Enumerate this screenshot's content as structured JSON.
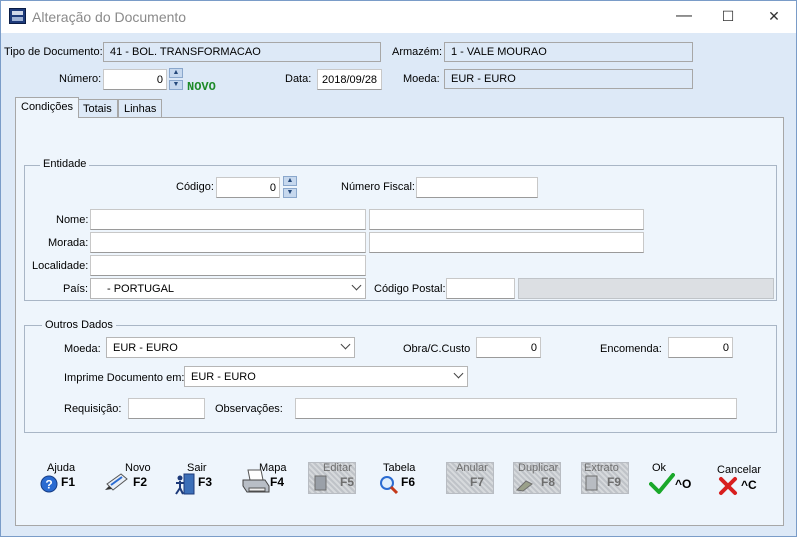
{
  "window": {
    "title": "Alteração do Documento",
    "minimize": "—",
    "maximize": "☐",
    "close": "✕"
  },
  "header": {
    "tipo_label": "Tipo de Documento:",
    "tipo_value": "41 - BOL. TRANSFORMACAO",
    "armazem_label": "Armazém:",
    "armazem_value": "1 - VALE MOURAO",
    "numero_label": "Número:",
    "numero_value": "0",
    "novo": "NOVO",
    "data_label": "Data:",
    "data_value": "2018/09/28",
    "moeda_label": "Moeda:",
    "moeda_value": "EUR - EURO"
  },
  "tabs": [
    {
      "label": "Condições"
    },
    {
      "label": "Totais"
    },
    {
      "label": "Linhas"
    }
  ],
  "entidade": {
    "legend": "Entidade",
    "codigo_label": "Código:",
    "codigo_value": "0",
    "nif_label": "Número Fiscal:",
    "nif_value": "",
    "nome_label": "Nome:",
    "nome_value": "",
    "nome2_value": "",
    "morada_label": "Morada:",
    "morada_value": "",
    "morada2_value": "",
    "localidade_label": "Localidade:",
    "localidade_value": "",
    "pais_label": "País:",
    "pais_value": "- PORTUGAL",
    "cp_label": "Código Postal:",
    "cp_value": "",
    "cp_desc_value": ""
  },
  "outros": {
    "legend": "Outros Dados",
    "moeda_label": "Moeda:",
    "moeda_value": "EUR - EURO",
    "obra_label": "Obra/C.Custo",
    "obra_value": "0",
    "encomenda_label": "Encomenda:",
    "encomenda_value": "0",
    "imprime_label": "Imprime Documento em:",
    "imprime_value": "EUR - EURO",
    "requisicao_label": "Requisição:",
    "requisicao_value": "",
    "observacoes_label": "Observações:",
    "observacoes_value": ""
  },
  "toolbar": [
    {
      "caption": "Ajuda",
      "key": "F1",
      "icon": "help-icon",
      "enabled": true
    },
    {
      "caption": "Novo",
      "key": "F2",
      "icon": "new-document-icon",
      "enabled": true
    },
    {
      "caption": "Sair",
      "key": "F3",
      "icon": "exit-door-icon",
      "enabled": true
    },
    {
      "caption": "Mapa",
      "key": "F4",
      "icon": "printer-icon",
      "enabled": true
    },
    {
      "caption": "Editar",
      "key": "F5",
      "icon": "edit-icon",
      "enabled": false
    },
    {
      "caption": "Tabela",
      "key": "F6",
      "icon": "magnifier-icon",
      "enabled": true
    },
    {
      "caption": "Anular",
      "key": "F7",
      "icon": "cancel-doc-icon",
      "enabled": false
    },
    {
      "caption": "Duplicar",
      "key": "F8",
      "icon": "duplicate-icon",
      "enabled": false
    },
    {
      "caption": "Extrato",
      "key": "F9",
      "icon": "statement-icon",
      "enabled": false
    },
    {
      "caption": "Ok",
      "key": "^O",
      "icon": "checkmark-icon",
      "enabled": true
    },
    {
      "caption": "Cancelar",
      "key": "^C",
      "icon": "red-x-icon",
      "enabled": true
    }
  ],
  "colors": {
    "client_bg": "#dde9f7",
    "panel_bg": "#eef5fc",
    "novo_green": "#1d8a28",
    "ok_green": "#1aa82a",
    "cancel_red": "#d81e1e"
  }
}
